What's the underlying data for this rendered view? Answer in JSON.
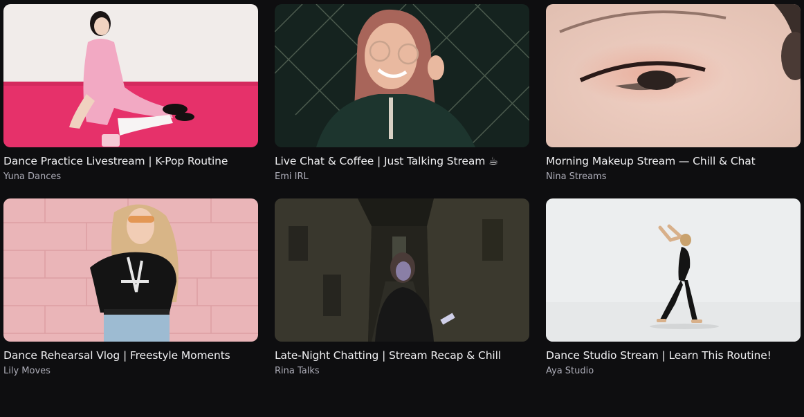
{
  "videos": [
    {
      "title": "Dance Practice Livestream | K-Pop Routine",
      "channel": "Yuna Dances",
      "thumbnail": "woman-in-pink-dress-sitting-on-pink-floor"
    },
    {
      "title": "Live Chat & Coffee | Just Talking Stream ☕",
      "channel": "Emi IRL",
      "thumbnail": "smiling-woman-with-round-glasses"
    },
    {
      "title": "Morning Makeup Stream — Chill & Chat",
      "channel": "Nina Streams",
      "thumbnail": "closeup-eye-makeup"
    },
    {
      "title": "Dance Rehearsal Vlog | Freestyle Moments",
      "channel": "Lily Moves",
      "thumbnail": "woman-against-pink-wall"
    },
    {
      "title": "Late-Night Chatting | Stream Recap & Chill",
      "channel": "Rina Talks",
      "thumbnail": "woman-with-phone-in-dark-alley"
    },
    {
      "title": "Dance Studio Stream | Learn This Routine!",
      "channel": "Aya Studio",
      "thumbnail": "dancer-in-white-studio"
    }
  ],
  "colors": {
    "background": "#0e0e10",
    "title": "#efeff1",
    "channel": "#adadb8"
  }
}
